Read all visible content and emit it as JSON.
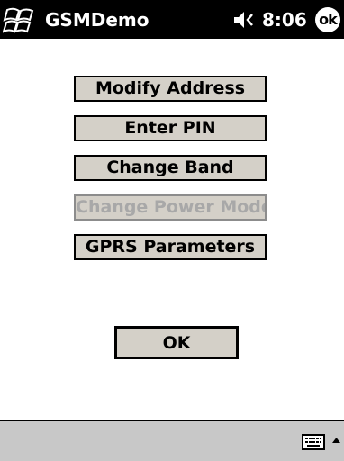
{
  "titlebar": {
    "app_title": "GSMDemo",
    "clock": "8:06",
    "ok_label": "ok",
    "icons": [
      "windows-start-icon",
      "speaker-muted-icon"
    ]
  },
  "menu": {
    "buttons": [
      {
        "label": "Modify Address",
        "enabled": true
      },
      {
        "label": "Enter PIN",
        "enabled": true
      },
      {
        "label": "Change Band",
        "enabled": true
      },
      {
        "label": "Change Power Mode",
        "enabled": false
      },
      {
        "label": "GPRS Parameters",
        "enabled": true
      }
    ]
  },
  "ok_button": {
    "label": "OK"
  },
  "bottombar": {
    "icons": [
      "keyboard-icon",
      "sip-arrow-icon"
    ]
  },
  "colors": {
    "titlebar_bg": "#000000",
    "button_face": "#d4d0c8",
    "disabled_text": "#a8a8a8",
    "bottombar_bg": "#c8c8c8"
  }
}
